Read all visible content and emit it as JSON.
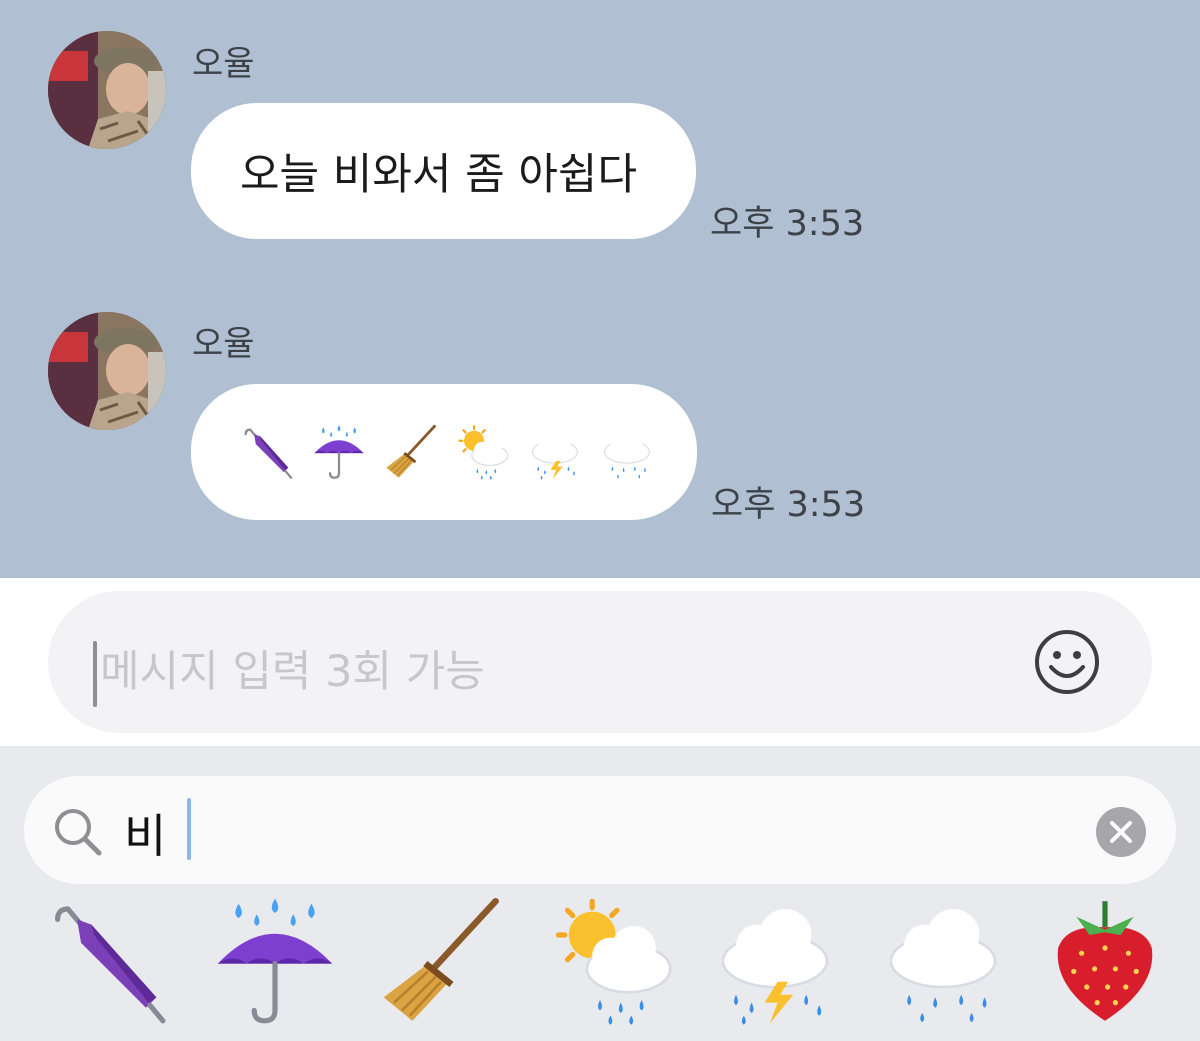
{
  "messages": [
    {
      "sender": "오율",
      "text": "오늘 비와서 좀 아쉽다",
      "time": "오후 3:53"
    },
    {
      "sender": "오율",
      "emojis": [
        "closed-umbrella-icon",
        "umbrella-with-rain-drops-icon",
        "broom-icon",
        "sun-behind-rain-cloud-icon",
        "cloud-with-lightning-and-rain-icon",
        "cloud-with-rain-icon"
      ],
      "time": "오후 3:53"
    }
  ],
  "composer": {
    "placeholder": "메시지 입력 3회 가능",
    "emoji_button_icon": "smiley-face-icon"
  },
  "emoji_search": {
    "query": "비",
    "search_icon": "search-icon",
    "clear_icon": "clear-icon",
    "results": [
      "closed-umbrella-icon",
      "umbrella-with-rain-drops-icon",
      "broom-icon",
      "sun-behind-rain-cloud-icon",
      "cloud-with-lightning-and-rain-icon",
      "cloud-with-rain-icon",
      "strawberry-icon"
    ]
  },
  "colors": {
    "chat_background": "#b0c0d2",
    "bubble": "#ffffff",
    "keyboard_background": "#e9eaee"
  }
}
